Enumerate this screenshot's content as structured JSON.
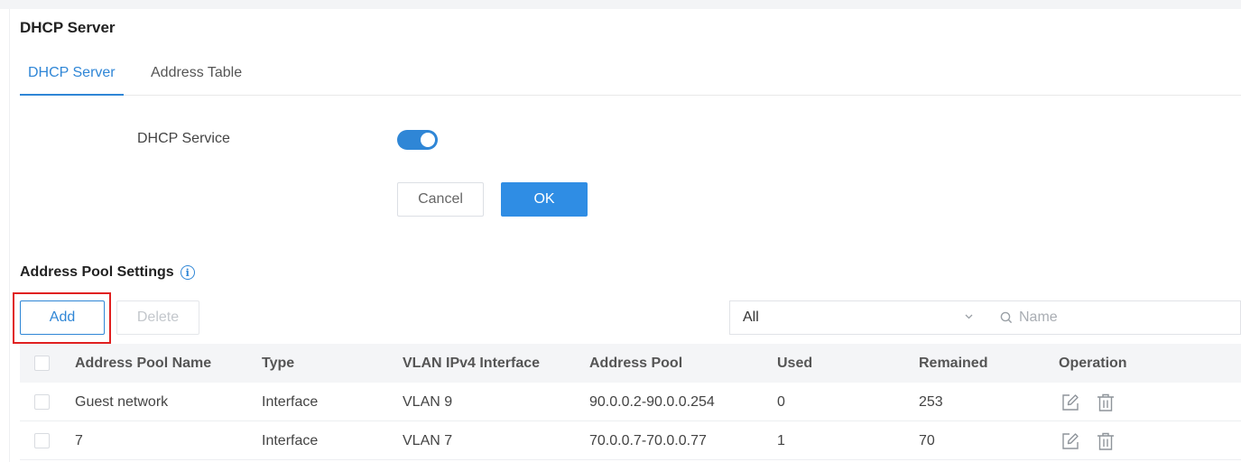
{
  "page": {
    "title": "DHCP Server",
    "tabs": [
      {
        "label": "DHCP Server",
        "active": true
      },
      {
        "label": "Address Table",
        "active": false
      }
    ]
  },
  "service": {
    "label": "DHCP Service",
    "enabled": true,
    "cancel_label": "Cancel",
    "ok_label": "OK"
  },
  "pool_settings": {
    "title": "Address Pool Settings",
    "info_icon": "info-icon",
    "add_label": "Add",
    "delete_label": "Delete",
    "filter_value": "All",
    "search_placeholder": "Name"
  },
  "table": {
    "headers": [
      "Address Pool Name",
      "Type",
      "VLAN IPv4 Interface",
      "Address Pool",
      "Used",
      "Remained",
      "Operation"
    ],
    "rows": [
      {
        "name": "Guest network",
        "type": "Interface",
        "vlan": "VLAN 9",
        "pool": "90.0.0.2-90.0.0.254",
        "used": "0",
        "remained": "253"
      },
      {
        "name": "7",
        "type": "Interface",
        "vlan": "VLAN 7",
        "pool": "70.0.0.7-70.0.0.77",
        "used": "1",
        "remained": "70"
      }
    ],
    "operation_icons": [
      "edit-icon",
      "trash-icon"
    ]
  },
  "colors": {
    "accent": "#2f86d6",
    "ok_button": "#2f8de4",
    "highlight": "#e02020"
  }
}
